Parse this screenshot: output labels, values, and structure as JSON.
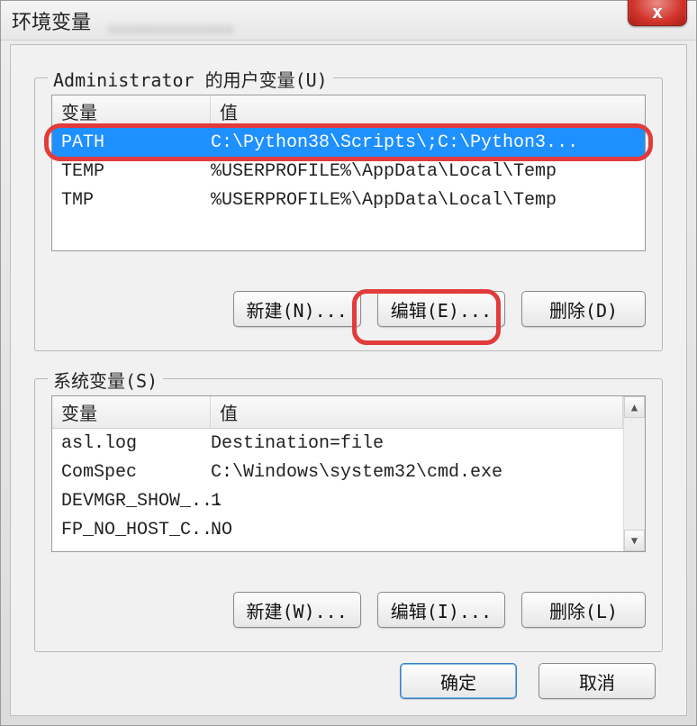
{
  "window": {
    "title": "环境变量",
    "blurred_text": "。。。。。。。。。。。。。。",
    "close_label": "x"
  },
  "user_vars": {
    "legend": "Administrator 的用户变量(U)",
    "columns": {
      "name": "变量",
      "value": "值"
    },
    "rows": [
      {
        "name": "PATH",
        "value": "C:\\Python38\\Scripts\\;C:\\Python3...",
        "selected": true
      },
      {
        "name": "TEMP",
        "value": "%USERPROFILE%\\AppData\\Local\\Temp",
        "selected": false
      },
      {
        "name": "TMP",
        "value": "%USERPROFILE%\\AppData\\Local\\Temp",
        "selected": false
      }
    ],
    "buttons": {
      "new": "新建(N)...",
      "edit": "编辑(E)...",
      "delete": "删除(D)"
    }
  },
  "sys_vars": {
    "legend": "系统变量(S)",
    "columns": {
      "name": "变量",
      "value": "值"
    },
    "rows": [
      {
        "name": "asl.log",
        "value": "Destination=file"
      },
      {
        "name": "ComSpec",
        "value": "C:\\Windows\\system32\\cmd.exe"
      },
      {
        "name": "DEVMGR_SHOW_...",
        "value": "1"
      },
      {
        "name": "FP_NO_HOST_C...",
        "value": "NO"
      }
    ],
    "buttons": {
      "new": "新建(W)...",
      "edit": "编辑(I)...",
      "delete": "删除(L)"
    }
  },
  "footer": {
    "ok": "确定",
    "cancel": "取消"
  },
  "highlights": {
    "path_row": true,
    "edit_button": true
  }
}
